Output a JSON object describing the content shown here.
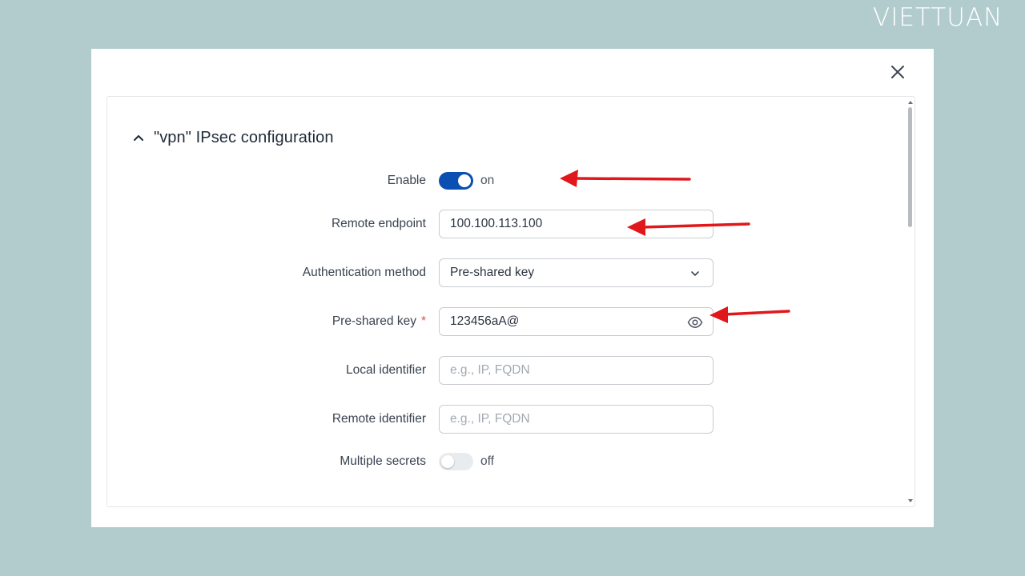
{
  "brand": "VIETTUAN",
  "section": {
    "title": "\"vpn\" IPsec configuration"
  },
  "form": {
    "enable": {
      "label": "Enable",
      "state": "on"
    },
    "remote_endpoint": {
      "label": "Remote endpoint",
      "value": "100.100.113.100"
    },
    "auth_method": {
      "label": "Authentication method",
      "value": "Pre-shared key"
    },
    "psk": {
      "label": "Pre-shared key",
      "required_mark": "*",
      "value": "123456aA@"
    },
    "local_identifier": {
      "label": "Local identifier",
      "value": "",
      "placeholder": "e.g., IP, FQDN"
    },
    "remote_identifier": {
      "label": "Remote identifier",
      "value": "",
      "placeholder": "e.g., IP, FQDN"
    },
    "multiple_secrets": {
      "label": "Multiple secrets",
      "state": "off"
    }
  },
  "colors": {
    "background": "#b2cccd",
    "toggle_on": "#0b4fb3",
    "annotation_arrow": "#e0181b",
    "required": "#d9534f"
  },
  "icons": [
    "close-icon",
    "chevron-up-icon",
    "chevron-down-icon",
    "eye-icon",
    "red-arrow"
  ]
}
